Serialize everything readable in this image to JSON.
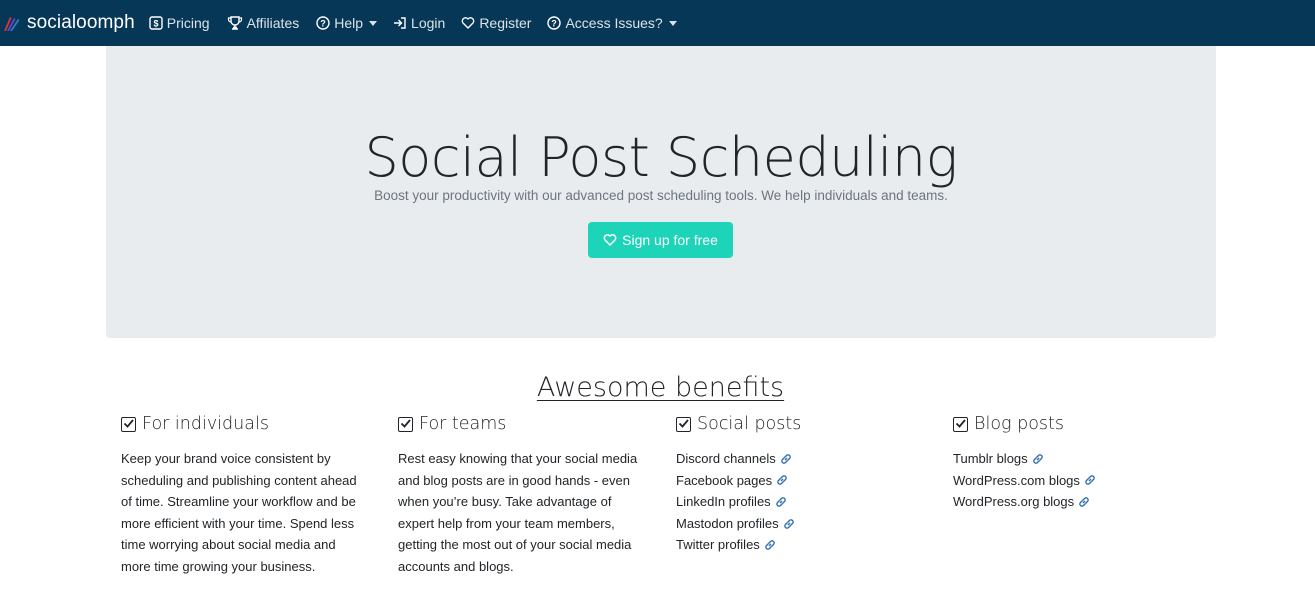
{
  "navbar": {
    "brand": "socialoomph",
    "items": [
      {
        "label": "Pricing",
        "icon": "dollar-square-icon"
      },
      {
        "label": "Affiliates",
        "icon": "trophy-icon"
      },
      {
        "label": "Help",
        "icon": "question-circle-icon",
        "dropdown": true
      },
      {
        "label": "Login",
        "icon": "sign-in-icon"
      },
      {
        "label": "Register",
        "icon": "heart-icon"
      },
      {
        "label": "Access Issues?",
        "icon": "question-circle-icon",
        "dropdown": true
      }
    ]
  },
  "hero": {
    "title": "Social Post Scheduling",
    "subtitle": "Boost your productivity with our advanced post scheduling tools. We help individuals and teams.",
    "button": "Sign up for free"
  },
  "benefits": {
    "title": "Awesome benefits",
    "columns": [
      {
        "heading": "For individuals",
        "text": "Keep your brand voice consistent by scheduling and publishing content ahead of time. Streamline your workflow and be more efficient with your time. Spend less time worrying about social media and more time growing your business."
      },
      {
        "heading": "For teams",
        "text": "Rest easy knowing that your social media and blog posts are in good hands - even when you’re busy. Take advantage of expert help from your team members, getting the most out of your social media accounts and blogs."
      },
      {
        "heading": "Social posts",
        "links": [
          "Discord channels",
          "Facebook pages",
          "LinkedIn profiles",
          "Mastodon profiles",
          "Twitter profiles"
        ]
      },
      {
        "heading": "Blog posts",
        "links": [
          "Tumblr blogs",
          "WordPress.com blogs",
          "WordPress.org blogs"
        ]
      }
    ]
  },
  "colors": {
    "navbar_bg": "#073756",
    "hero_bg": "#e9ecef",
    "button_bg": "#1dd3b8",
    "link_icon": "#2f6fae"
  }
}
